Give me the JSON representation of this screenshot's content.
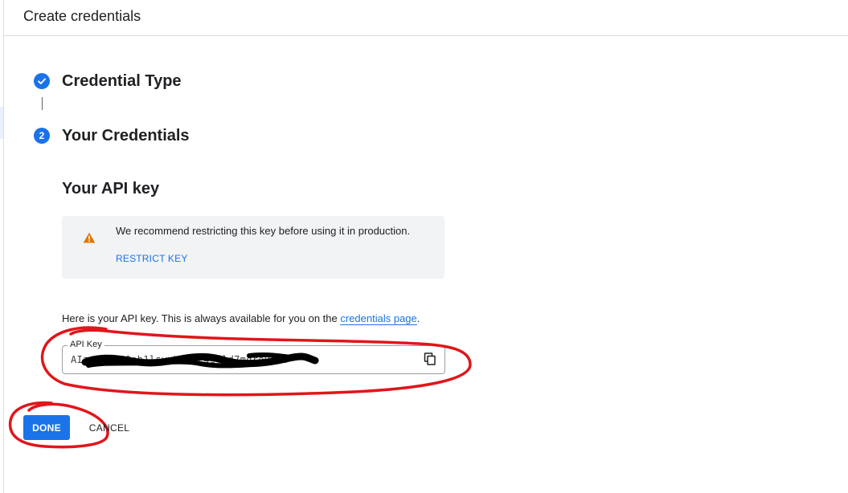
{
  "header": {
    "title": "Create credentials"
  },
  "stepper": {
    "steps": [
      {
        "label": "Credential Type",
        "state": "complete",
        "icon": "check-icon"
      },
      {
        "label": "Your Credentials",
        "state": "current",
        "number": "2"
      }
    ]
  },
  "api_key_section": {
    "title": "Your API key",
    "warning": {
      "icon": "warning-icon",
      "message": "We recommend restricting this key before using it in production.",
      "action_label": "RESTRICT KEY"
    },
    "info_prefix": "Here is your API key. This is always available for you on the ",
    "info_link": "credentials page",
    "info_suffix": ".",
    "field": {
      "label": "API Key",
      "value": "AIzaSyCZQ9eb1lsvyKWANc4sfld7mqrevdN8"
    },
    "copy_icon": "copy-icon"
  },
  "actions": {
    "done_label": "DONE",
    "cancel_label": "CANCEL"
  },
  "colors": {
    "accent": "#1a73e8",
    "warning": "#e37400",
    "annotation": "#e0161b"
  }
}
